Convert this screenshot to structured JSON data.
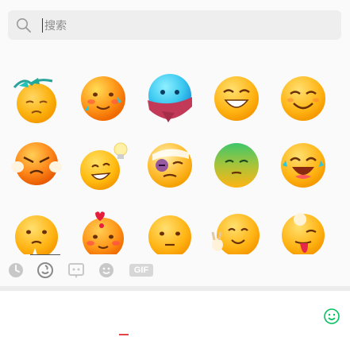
{
  "search": {
    "placeholder": "搜索"
  },
  "toolbar": {
    "gif_label": "GIF"
  },
  "colors": {
    "accent_green": "#07c160",
    "panel_bg": "#fafafa",
    "search_bg": "#eeeeee",
    "tool_icon": "#c8c8c8"
  },
  "emojis": [
    "emoji-bird-on-head",
    "emoji-blushing",
    "emoji-cold-scarf",
    "emoji-big-grin",
    "emoji-smile",
    "emoji-angry-pout",
    "emoji-idea-bulb",
    "emoji-bruised",
    "emoji-green-face",
    "emoji-laughing",
    "emoji-sweating",
    "emoji-in-love",
    "emoji-neutral",
    "emoji-peace-sign",
    "emoji-tongue-out"
  ],
  "toolbar_icons": [
    "recent-icon",
    "sticker-icon",
    "custom-sticker-icon",
    "emoji-face-icon",
    "gif-icon"
  ],
  "input_icons": [
    "smile-icon"
  ]
}
